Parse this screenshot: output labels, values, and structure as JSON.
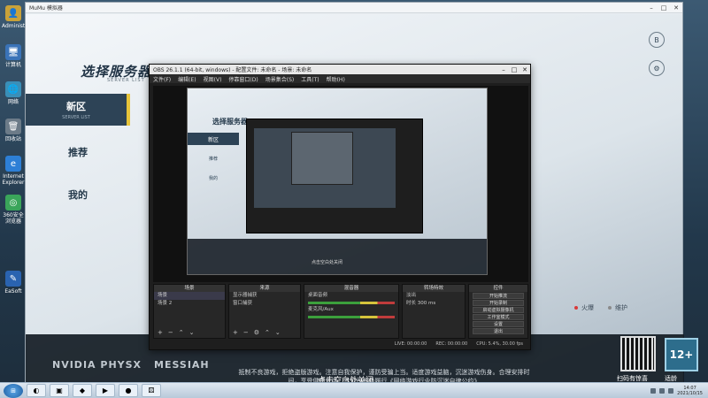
{
  "desktop": {
    "icons": [
      {
        "label": "Administrator",
        "glyph": "👤",
        "color": "#c9a23a"
      },
      {
        "label": "计算机",
        "glyph": "🖥",
        "color": "#3a73b8"
      },
      {
        "label": "网络",
        "glyph": "🌐",
        "color": "#3a8fb8"
      },
      {
        "label": "回收站",
        "glyph": "🗑",
        "color": "#6c7b88"
      },
      {
        "label": "Internet Explorer",
        "glyph": "e",
        "color": "#2d7fd6"
      },
      {
        "label": "360安全浏览器",
        "glyph": "◎",
        "color": "#3aa55a"
      },
      {
        "label": "EaSoft",
        "glyph": "✎",
        "color": "#2a63b0"
      }
    ]
  },
  "game_window": {
    "title": "MuMu 模拟器",
    "page_title": "选择服务器",
    "page_subtitle": "SERVER LIST",
    "nav": [
      {
        "label": "新区",
        "en": "SERVER LIST",
        "active": true
      },
      {
        "label": "推荐",
        "en": "",
        "active": false
      },
      {
        "label": "我的",
        "en": "",
        "active": false
      }
    ],
    "right_icons": [
      "B",
      "⚙"
    ],
    "legend": [
      {
        "label": "火爆",
        "color": "#d83a3a"
      },
      {
        "label": "维护",
        "color": "#8a8a8a"
      }
    ],
    "logos": [
      "NVIDIA PHYSX",
      "MESSIAH"
    ],
    "notice": "抵制不良游戏，拒绝盗版游戏。注意自我保护，谨防受骗上当。适度游戏益脑，沉迷游戏伤身。合理安排时间，享受健康生活。本公司积极履行《网络游戏行业防沉迷自律公约》",
    "close_hint": "点击空白处关闭",
    "qr_label": "扫码有惊喜",
    "age_badge": "12+",
    "age_label": "适龄提示"
  },
  "obs": {
    "title": "OBS 26.1.1 (64-bit, windows) - 配置文件: 未命名 - 场景: 未命名",
    "menu": [
      "文件(F)",
      "编辑(E)",
      "视图(V)",
      "停靠窗口(D)",
      "场景集合(S)",
      "工具(T)",
      "帮助(H)"
    ],
    "nested_title": "选择服务器",
    "nested_nav": [
      "新区",
      "推荐",
      "我的"
    ],
    "nested_hint": "点击空白处关闭",
    "docks": {
      "scenes": {
        "header": "场景",
        "items": [
          "场景",
          "场景 2"
        ]
      },
      "sources": {
        "header": "来源",
        "items": [
          "显示器捕获",
          "窗口捕获"
        ]
      },
      "mixer": {
        "header": "混音器",
        "channels": [
          "桌面音频",
          "麦克风/Aux"
        ]
      },
      "transitions": {
        "header": "转场特效",
        "type": "淡出",
        "duration_label": "时长",
        "duration": "300 ms"
      },
      "controls": {
        "header": "控件",
        "buttons": [
          "开始推流",
          "开始录制",
          "启动虚拟摄像机",
          "工作室模式",
          "设置",
          "退出"
        ]
      }
    },
    "status": {
      "live": "LIVE: 00:00:00",
      "rec": "REC: 00:00:00",
      "cpu": "CPU: 5.4%, 30.00 fps"
    }
  },
  "taskbar": {
    "items": [
      "◐",
      "▣",
      "◆",
      "▶",
      "●",
      "⚄"
    ],
    "time": "14:07",
    "date": "2021/10/15"
  }
}
